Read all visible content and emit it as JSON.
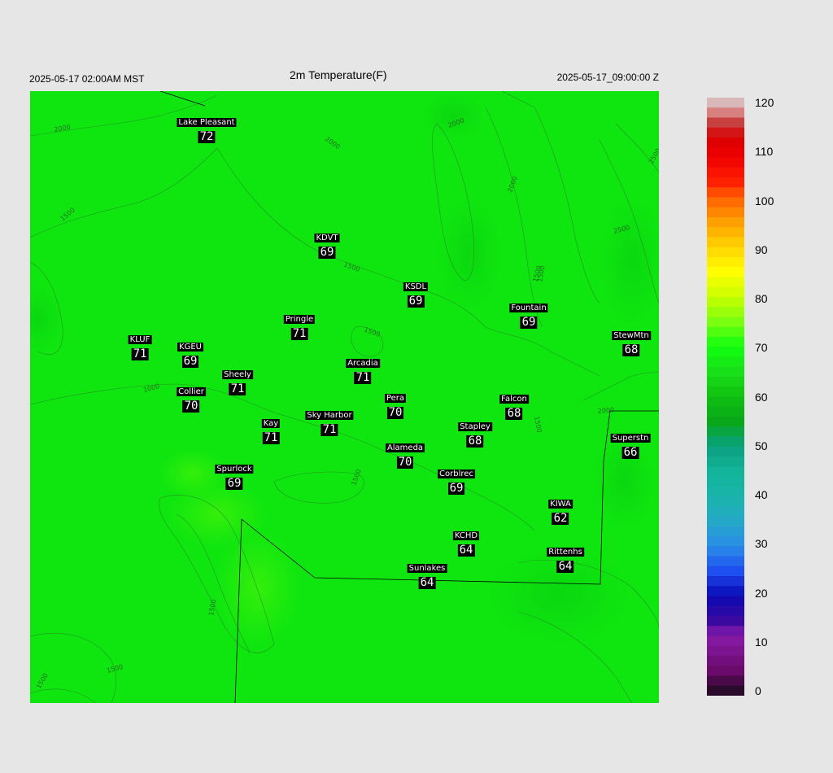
{
  "header": {
    "left": "2025-05-17 02:00AM MST",
    "title": "2m Temperature(F)",
    "right": "2025-05-17_09:00:00 Z"
  },
  "map": {
    "background_color": "#0fe60f",
    "stations": [
      {
        "name": "Lake Pleasant",
        "value": "72"
      },
      {
        "name": "KDVT",
        "value": "69"
      },
      {
        "name": "KSDL",
        "value": "69"
      },
      {
        "name": "Fountain",
        "value": "69"
      },
      {
        "name": "StewMtn",
        "value": "68"
      },
      {
        "name": "Pringle",
        "value": "71"
      },
      {
        "name": "KLUF",
        "value": "71"
      },
      {
        "name": "KGEU",
        "value": "69"
      },
      {
        "name": "Arcadia",
        "value": "71"
      },
      {
        "name": "Sheely",
        "value": "71"
      },
      {
        "name": "Collier",
        "value": "70"
      },
      {
        "name": "Pera",
        "value": "70"
      },
      {
        "name": "Falcon",
        "value": "68"
      },
      {
        "name": "Kay",
        "value": "71"
      },
      {
        "name": "Sky Harbor",
        "value": "71"
      },
      {
        "name": "Stapley",
        "value": "68"
      },
      {
        "name": "Superstn",
        "value": "66"
      },
      {
        "name": "Alameda",
        "value": "70"
      },
      {
        "name": "Spurlock",
        "value": "69"
      },
      {
        "name": "Corblrec",
        "value": "69"
      },
      {
        "name": "KIWA",
        "value": "62"
      },
      {
        "name": "KCHD",
        "value": "64"
      },
      {
        "name": "Rittenhs",
        "value": "64"
      },
      {
        "name": "Sunlakes",
        "value": "64"
      }
    ],
    "contour_labels": [
      "2000",
      "2000",
      "2000",
      "1500",
      "1500",
      "2500",
      "2000",
      "1500",
      "2500",
      "1500",
      "1000",
      "1500",
      "2000",
      "1500",
      "1500",
      "1500",
      "1500",
      "1500"
    ]
  },
  "colorbar": {
    "labels": [
      "120",
      "110",
      "100",
      "90",
      "80",
      "70",
      "60",
      "50",
      "40",
      "30",
      "20",
      "10",
      "0"
    ]
  }
}
